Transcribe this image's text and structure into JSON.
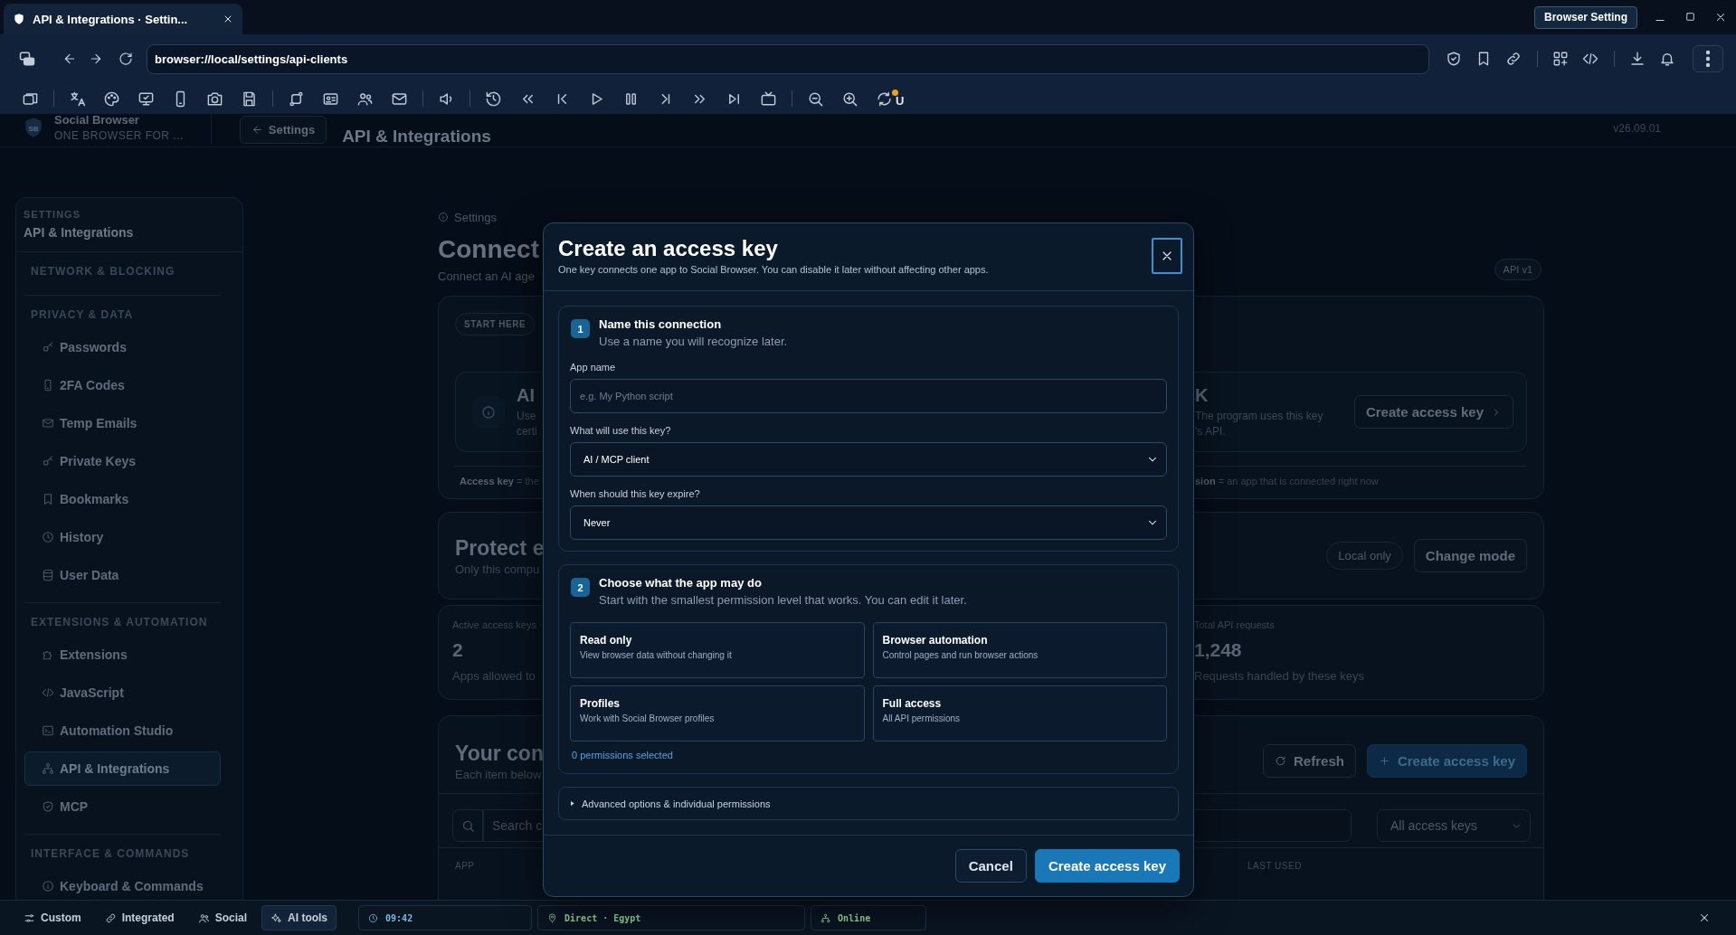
{
  "browser_tab": {
    "title": "API & Integrations · Settin...",
    "selected": true
  },
  "browser_setting_button": "Browser Setting",
  "address_bar": {
    "url": "browser://local/settings/api-clients"
  },
  "toolbar": {
    "badge": "U"
  },
  "app_header": {
    "logo": "SB",
    "brand": "Social Browser",
    "tagline": "ONE BROWSER FOR ...",
    "back_button": "Settings",
    "title": "API & Integrations",
    "version": "v26.09.01"
  },
  "sidebar": {
    "label": "SETTINGS",
    "current": "API & Integrations",
    "groups": [
      {
        "title": "NETWORK & BLOCKING"
      },
      {
        "title": "PRIVACY & DATA",
        "items": [
          {
            "label": "Passwords",
            "selected": false
          },
          {
            "label": "2FA Codes",
            "selected": false
          },
          {
            "label": "Temp Emails",
            "selected": false
          },
          {
            "label": "Private Keys",
            "selected": false
          },
          {
            "label": "Bookmarks",
            "selected": false
          },
          {
            "label": "History",
            "selected": false
          },
          {
            "label": "User Data",
            "selected": false
          }
        ]
      },
      {
        "title": "EXTENSIONS & AUTOMATION",
        "items": [
          {
            "label": "Extensions",
            "selected": false
          },
          {
            "label": "JavaScript",
            "selected": false
          },
          {
            "label": "Automation Studio",
            "selected": false
          },
          {
            "label": "API & Integrations",
            "selected": true
          },
          {
            "label": "MCP",
            "selected": false
          }
        ]
      },
      {
        "title": "INTERFACE & COMMANDS",
        "items": [
          {
            "label": "Keyboard & Commands",
            "selected": false
          }
        ]
      }
    ]
  },
  "page": {
    "breadcrumb": "Settings",
    "heading": "Connect",
    "subheading": "Connect an AI age",
    "api_badge": "API v1",
    "intro_card": {
      "pill": "START HERE",
      "option_left": {
        "title": "AI",
        "lines": [
          "Use",
          "certi"
        ]
      },
      "option_right": {
        "title": "K",
        "lines": [
          "The program uses this key",
          "'s API."
        ],
        "button": "Create access key"
      },
      "legend": [
        "**Access key** = the",
        "**sion** = an app that is connected right now"
      ]
    },
    "mode_card": {
      "title": "Protect e",
      "description": "Only this compu",
      "badge": "Local only",
      "button": "Change mode"
    },
    "stats": [
      {
        "label": "Active access keys",
        "value": "2",
        "note": "Apps allowed to"
      },
      {
        "label": "Total API requests",
        "value": "1,248",
        "note": "Requests handled by these keys"
      }
    ],
    "connections": {
      "title": "Your con",
      "description": "Each item below",
      "refresh_button": "Refresh",
      "create_button": "Create access key",
      "search": {
        "placeholder": "Search c"
      },
      "filter": "All access keys",
      "columns": [
        "APP",
        "LAST USED"
      ]
    }
  },
  "dialog": {
    "title": "Create an access key",
    "description": "One key connects one app to Social Browser. You can disable it later without affecting other apps.",
    "steps": [
      {
        "number": "1",
        "title": "Name this connection",
        "hint": "Use a name you will recognize later."
      },
      {
        "number": "2",
        "title": "Choose what the app may do",
        "hint": "Start with the smallest permission level that works. You can edit it later."
      }
    ],
    "fields": [
      {
        "kind": "text",
        "label": "App name",
        "placeholder": "e.g. My Python script"
      },
      {
        "kind": "select",
        "label": "What will use this key?",
        "value": "AI / MCP client"
      },
      {
        "kind": "select",
        "label": "When should this key expire?",
        "value": "Never"
      }
    ],
    "presets": [
      {
        "title": "Read only",
        "description": "View browser data without changing it",
        "selected": false
      },
      {
        "title": "Browser automation",
        "description": "Control pages and run browser actions",
        "selected": false
      },
      {
        "title": "Profiles",
        "description": "Work with Social Browser profiles",
        "selected": false
      },
      {
        "title": "Full access",
        "description": "All API permissions",
        "selected": false
      }
    ],
    "selection_count": "0 permissions selected",
    "advanced": {
      "label": "Advanced options & individual permissions",
      "expanded": false
    },
    "buttons": [
      {
        "kind": "secondary",
        "label": "Cancel"
      },
      {
        "kind": "primary",
        "label": "Create access key"
      }
    ]
  },
  "status_bar": {
    "modes": [
      {
        "label": "Custom",
        "selected": false
      },
      {
        "label": "Integrated",
        "selected": false
      },
      {
        "label": "Social",
        "selected": false
      },
      {
        "label": "AI tools",
        "selected": true
      }
    ],
    "time": "09:42",
    "route": "Direct · Egypt",
    "connection": "Online"
  }
}
